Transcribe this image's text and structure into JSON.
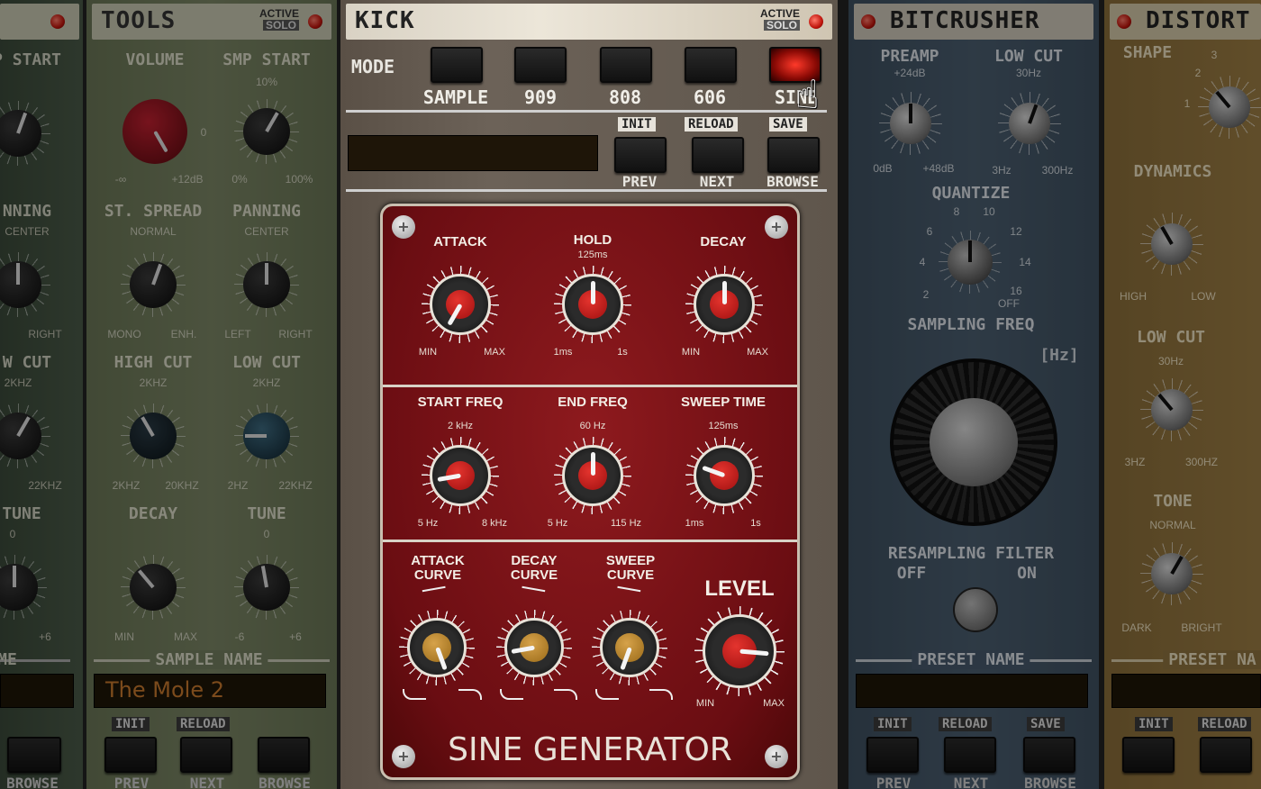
{
  "panel_far_left": {
    "labels": [
      "P START",
      "NNING",
      "CENTER",
      "RIGHT",
      "W CUT",
      "2KHZ",
      "22KHZ",
      "TUNE",
      "0",
      "+6",
      "ME"
    ],
    "browse": "BROWSE"
  },
  "tools": {
    "title": "TOOLS",
    "active": "ACTIVE",
    "solo": "SOLO",
    "volume": {
      "label": "VOLUME",
      "min": "-∞",
      "zero": "0",
      "max": "+12dB"
    },
    "smp_start": {
      "label": "SMP START",
      "value": "10%",
      "min": "0%",
      "max": "100%"
    },
    "st_spread": {
      "label": "ST. SPREAD",
      "value": "NORMAL",
      "min": "MONO",
      "max": "ENH."
    },
    "panning": {
      "label": "PANNING",
      "value": "CENTER",
      "min": "LEFT",
      "max": "RIGHT"
    },
    "high_cut": {
      "label": "HIGH CUT",
      "value": "2KHZ",
      "min": "2KHZ",
      "max": "20KHZ"
    },
    "low_cut": {
      "label": "LOW CUT",
      "value": "2KHZ",
      "min": "2HZ",
      "max": "22KHZ"
    },
    "decay": {
      "label": "DECAY",
      "min": "MIN",
      "max": "MAX"
    },
    "tune": {
      "label": "TUNE",
      "value": "0",
      "min": "-6",
      "max": "+6"
    },
    "sample_name_label": "SAMPLE NAME",
    "sample_name": "The Mole 2",
    "init": "INIT",
    "reload": "RELOAD",
    "prev": "PREV",
    "next": "NEXT",
    "browse": "BROWSE"
  },
  "kick": {
    "title": "KICK",
    "active": "ACTIVE",
    "solo": "SOLO",
    "mode_label": "MODE",
    "modes": [
      "SAMPLE",
      "909",
      "808",
      "606",
      "SINE"
    ],
    "selected_mode": "SINE",
    "init": "INIT",
    "reload": "RELOAD",
    "save": "SAVE",
    "prev": "PREV",
    "next": "NEXT",
    "browse": "BROWSE",
    "preset_display": "",
    "generator_title": "SINE GENERATOR",
    "attack": {
      "label": "ATTACK",
      "min": "MIN",
      "max": "MAX"
    },
    "hold": {
      "label": "HOLD",
      "value": "125ms",
      "min": "1ms",
      "max": "1s"
    },
    "decay": {
      "label": "DECAY",
      "min": "MIN",
      "max": "MAX"
    },
    "start_freq": {
      "label": "START FREQ",
      "value": "2 kHz",
      "min": "5 Hz",
      "max": "8 kHz"
    },
    "end_freq": {
      "label": "END FREQ",
      "value": "60 Hz",
      "min": "5 Hz",
      "max": "115 Hz"
    },
    "sweep_time": {
      "label": "SWEEP TIME",
      "value": "125ms",
      "min": "1ms",
      "max": "1s"
    },
    "attack_curve": {
      "label1": "ATTACK",
      "label2": "CURVE"
    },
    "decay_curve": {
      "label1": "DECAY",
      "label2": "CURVE"
    },
    "sweep_curve": {
      "label1": "SWEEP",
      "label2": "CURVE"
    },
    "level": {
      "label": "LEVEL",
      "min": "MIN",
      "max": "MAX"
    }
  },
  "bitcrusher": {
    "title": "BITCRUSHER",
    "preamp": {
      "label": "PREAMP",
      "value": "+24dB",
      "min": "0dB",
      "max": "+48dB"
    },
    "low_cut": {
      "label": "LOW CUT",
      "value": "30Hz",
      "min": "3Hz",
      "max": "300Hz"
    },
    "quantize": {
      "label": "QUANTIZE",
      "ticks": [
        "2",
        "4",
        "6",
        "8",
        "10",
        "12",
        "14",
        "16",
        "OFF"
      ]
    },
    "sampling_freq": {
      "label": "SAMPLING FREQ",
      "unit": "[Hz]"
    },
    "resampling_filter": {
      "label": "RESAMPLING FILTER",
      "off": "OFF",
      "on": "ON"
    },
    "preset_name_label": "PRESET NAME",
    "init": "INIT",
    "reload": "RELOAD",
    "save": "SAVE",
    "prev": "PREV",
    "next": "NEXT",
    "browse": "BROWSE"
  },
  "distortion": {
    "title": "DISTORT",
    "shape": {
      "label": "SHAPE",
      "ticks": [
        "1",
        "2",
        "3"
      ]
    },
    "dynamics": {
      "label": "DYNAMICS",
      "min": "HIGH",
      "max": "LOW"
    },
    "low_cut": {
      "label": "LOW CUT",
      "value": "30Hz",
      "min": "3HZ",
      "max": "300HZ"
    },
    "tone": {
      "label": "TONE",
      "value": "NORMAL",
      "min": "DARK",
      "max": "BRIGHT"
    },
    "preset_name_label": "PRESET NA",
    "init": "INIT",
    "reload": "RELOAD"
  }
}
